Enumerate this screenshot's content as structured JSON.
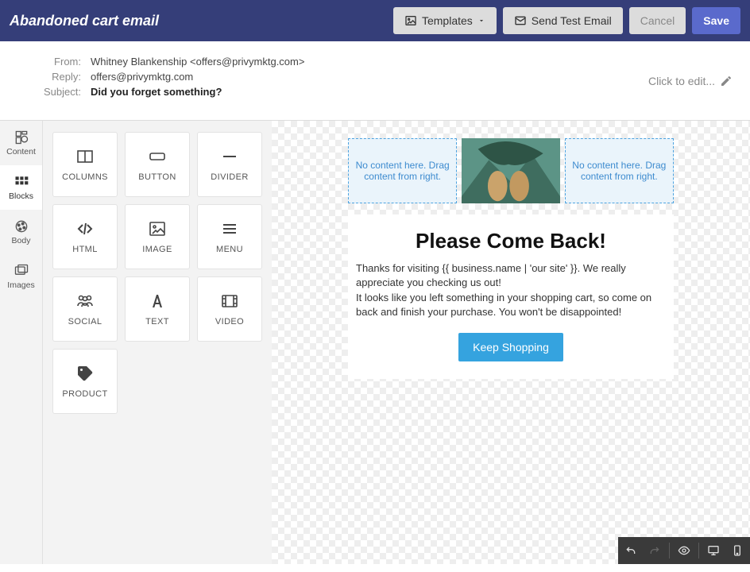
{
  "header": {
    "title": "Abandoned cart email",
    "templates_label": "Templates",
    "send_test_label": "Send Test Email",
    "cancel_label": "Cancel",
    "save_label": "Save"
  },
  "meta": {
    "from_label": "From:",
    "from_value": "Whitney Blankenship <offers@privymktg.com>",
    "reply_label": "Reply:",
    "reply_value": "offers@privymktg.com",
    "subject_label": "Subject:",
    "subject_value": "Did you forget something?",
    "click_to_edit": "Click to edit..."
  },
  "sidebar": {
    "tabs": [
      {
        "label": "Content"
      },
      {
        "label": "Blocks"
      },
      {
        "label": "Body"
      },
      {
        "label": "Images"
      }
    ]
  },
  "blocks": [
    {
      "id": "columns",
      "label": "COLUMNS"
    },
    {
      "id": "button",
      "label": "BUTTON"
    },
    {
      "id": "divider",
      "label": "DIVIDER"
    },
    {
      "id": "html",
      "label": "HTML"
    },
    {
      "id": "image",
      "label": "IMAGE"
    },
    {
      "id": "menu",
      "label": "MENU"
    },
    {
      "id": "social",
      "label": "SOCIAL"
    },
    {
      "id": "text",
      "label": "TEXT"
    },
    {
      "id": "video",
      "label": "VIDEO"
    },
    {
      "id": "product",
      "label": "PRODUCT"
    }
  ],
  "canvas": {
    "empty_slot_text": "No content here. Drag content from right.",
    "heading": "Please Come Back!",
    "paragraph1": "Thanks for visiting {{ business.name | 'our site' }}. We really appreciate you checking us out!",
    "paragraph2": "It looks like you left something in your shopping cart, so come on back and finish your purchase. You won't be disappointed!",
    "cta_label": "Keep Shopping"
  },
  "bottom_toolbar": {
    "undo": "Undo",
    "redo": "Redo",
    "preview": "Preview",
    "desktop": "Desktop view",
    "mobile": "Mobile view"
  }
}
